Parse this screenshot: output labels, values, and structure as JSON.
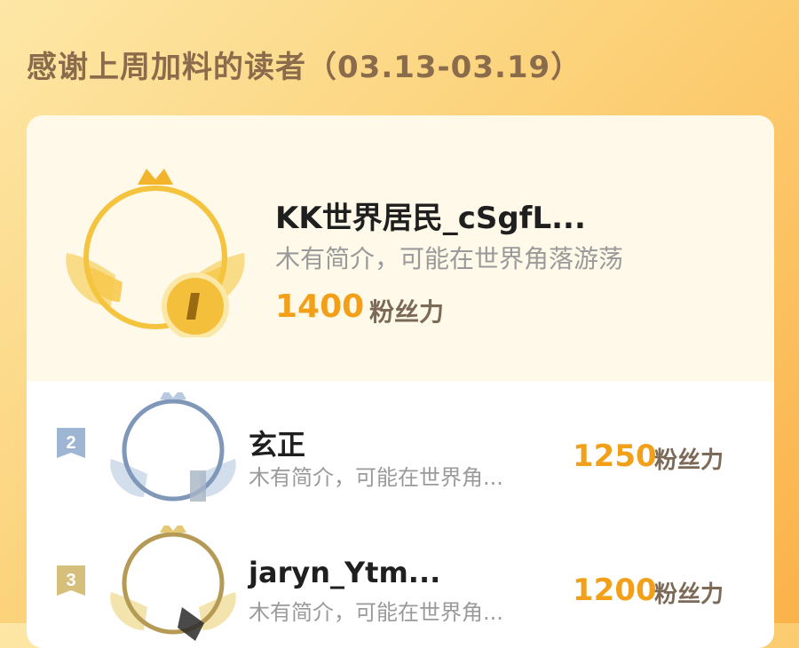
{
  "header": {
    "title": "感谢上周加料的读者（03.13-03.19）"
  },
  "ranking": [
    {
      "rank": "1",
      "name": "KK世界居民_cSgfL...",
      "desc": "木有简介，可能在世界角落游荡",
      "score": "1400",
      "unit": "粉丝力"
    },
    {
      "rank": "2",
      "name": "玄正",
      "desc": "木有简介，可能在世界角...",
      "score": "1250",
      "unit": "粉丝力"
    },
    {
      "rank": "3",
      "name": "jaryn_Ytm...",
      "desc": "木有简介，可能在世界角...",
      "score": "1200",
      "unit": "粉丝力"
    }
  ],
  "colors": {
    "gold": "#f2a019",
    "silver": "#7f97b8",
    "bronze": "#b59a55"
  },
  "icons": {
    "crown": "crown-icon",
    "wings": "wings-icon",
    "medal": "medal-icon"
  }
}
